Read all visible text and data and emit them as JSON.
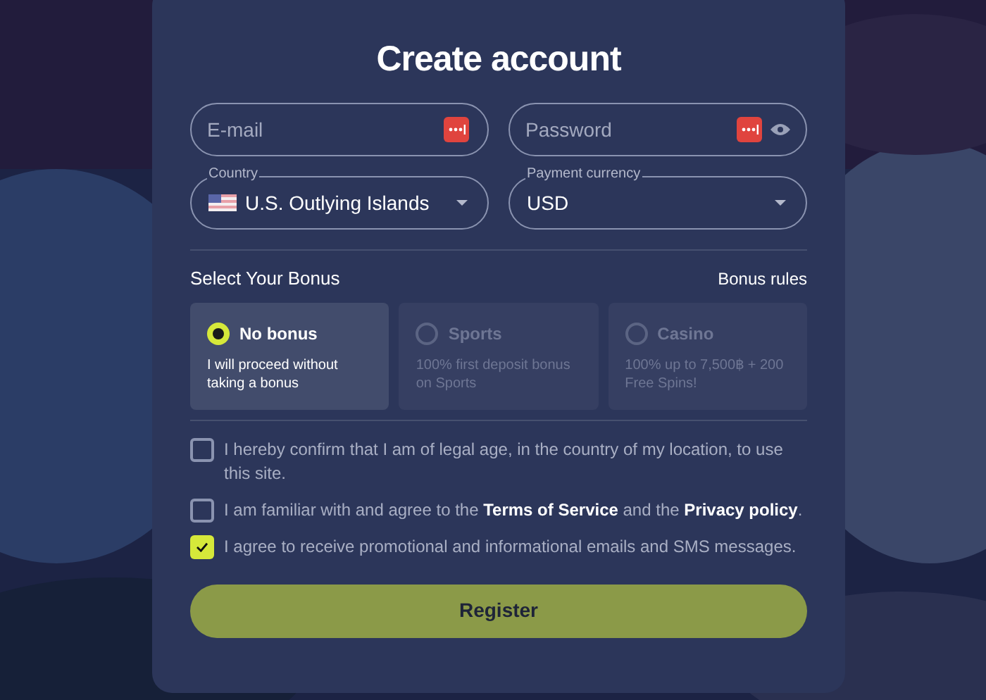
{
  "title": "Create account",
  "fields": [
    {
      "placeholder": "E-mail",
      "reveal": false
    },
    {
      "placeholder": "Password",
      "reveal": true
    }
  ],
  "selects": [
    {
      "label": "Country",
      "value": "U.S. Outlying Islands",
      "flag": true
    },
    {
      "label": "Payment currency",
      "value": "USD",
      "flag": false
    }
  ],
  "bonus": {
    "heading": "Select Your Bonus",
    "rules_link": "Bonus rules",
    "options": [
      {
        "title": "No bonus",
        "description": "I will proceed without taking a bonus",
        "selected": true
      },
      {
        "title": "Sports",
        "description": "100% first deposit bonus on Sports",
        "selected": false
      },
      {
        "title": "Casino",
        "description": "100% up to 7,500฿ + 200 Free Spins!",
        "selected": false
      }
    ]
  },
  "agreements": [
    {
      "checked": false,
      "parts": [
        {
          "kind": "text",
          "text": "I hereby confirm that I am of legal age, in the country of my location, to use this site."
        }
      ]
    },
    {
      "checked": false,
      "parts": [
        {
          "kind": "text",
          "text": "I am familiar with and agree to the "
        },
        {
          "kind": "link",
          "text": "Terms of Service"
        },
        {
          "kind": "text",
          "text": " and the "
        },
        {
          "kind": "link",
          "text": "Privacy policy"
        },
        {
          "kind": "text",
          "text": "."
        }
      ]
    },
    {
      "checked": true,
      "parts": [
        {
          "kind": "text",
          "text": "I agree to receive promotional and informational emails and SMS messages."
        }
      ]
    }
  ],
  "submit": "Register"
}
